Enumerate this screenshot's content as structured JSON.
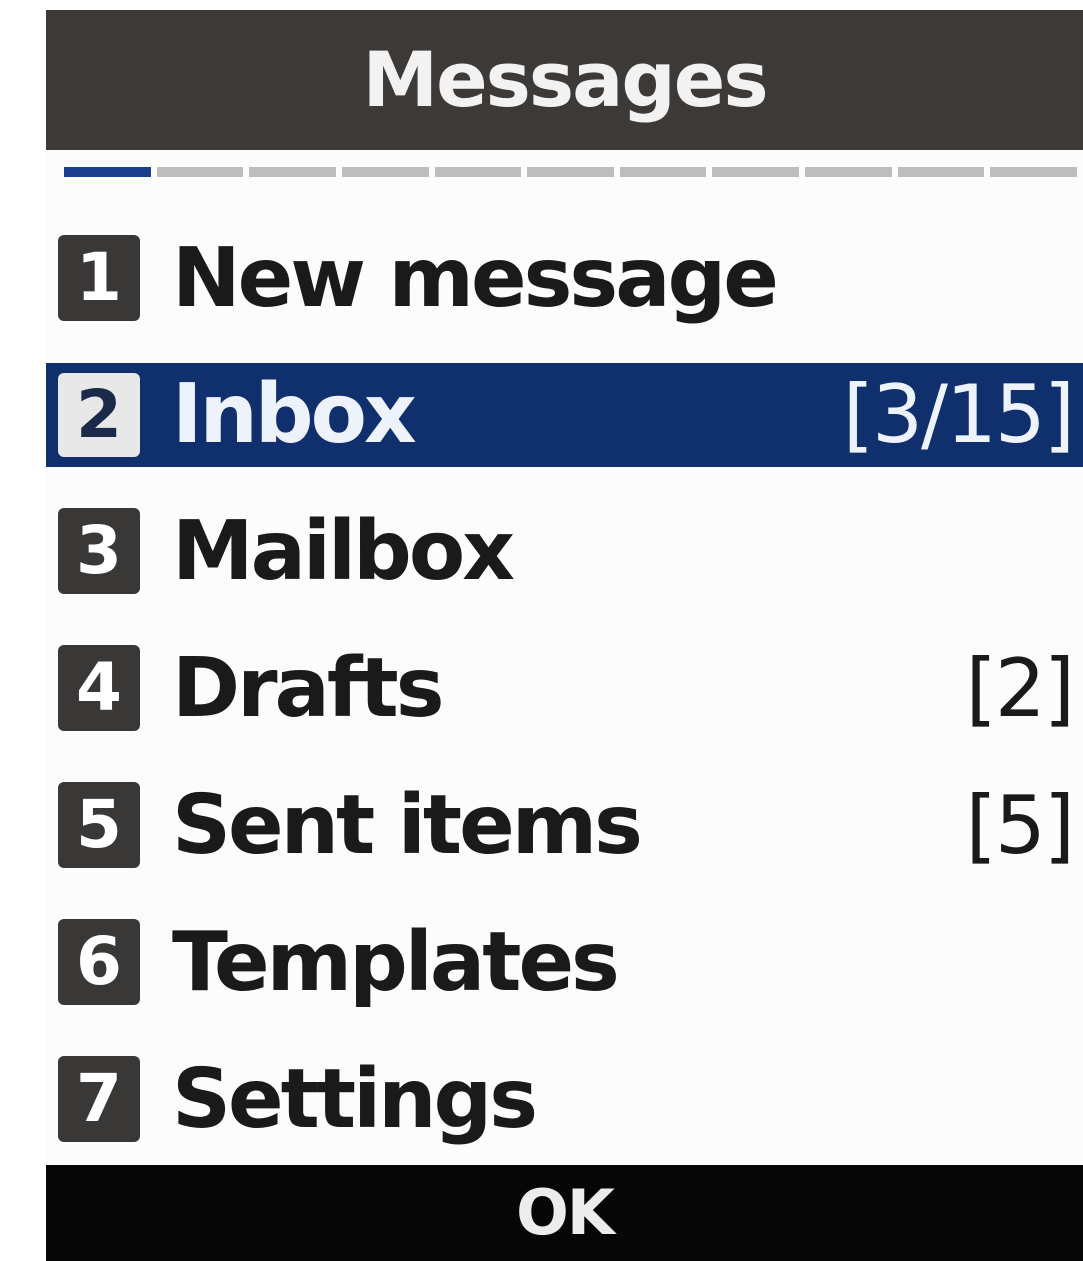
{
  "header": {
    "title": "Messages"
  },
  "page_indicator": {
    "total_pages": 11,
    "current_page": 1
  },
  "menu": {
    "items": [
      {
        "number": "1",
        "label": "New message",
        "count": ""
      },
      {
        "number": "2",
        "label": "Inbox",
        "count": "[3/15]"
      },
      {
        "number": "3",
        "label": "Mailbox",
        "count": ""
      },
      {
        "number": "4",
        "label": "Drafts",
        "count": "[2]"
      },
      {
        "number": "5",
        "label": "Sent items",
        "count": "[5]"
      },
      {
        "number": "6",
        "label": "Templates",
        "count": ""
      },
      {
        "number": "7",
        "label": "Settings",
        "count": ""
      }
    ],
    "selected_index": 1
  },
  "softkey": {
    "center_label": "OK"
  },
  "colors": {
    "title_bg": "#3d3936",
    "highlight": "#10306d",
    "indicator_active": "#1b3f8e",
    "softkey_bg": "#060606"
  }
}
